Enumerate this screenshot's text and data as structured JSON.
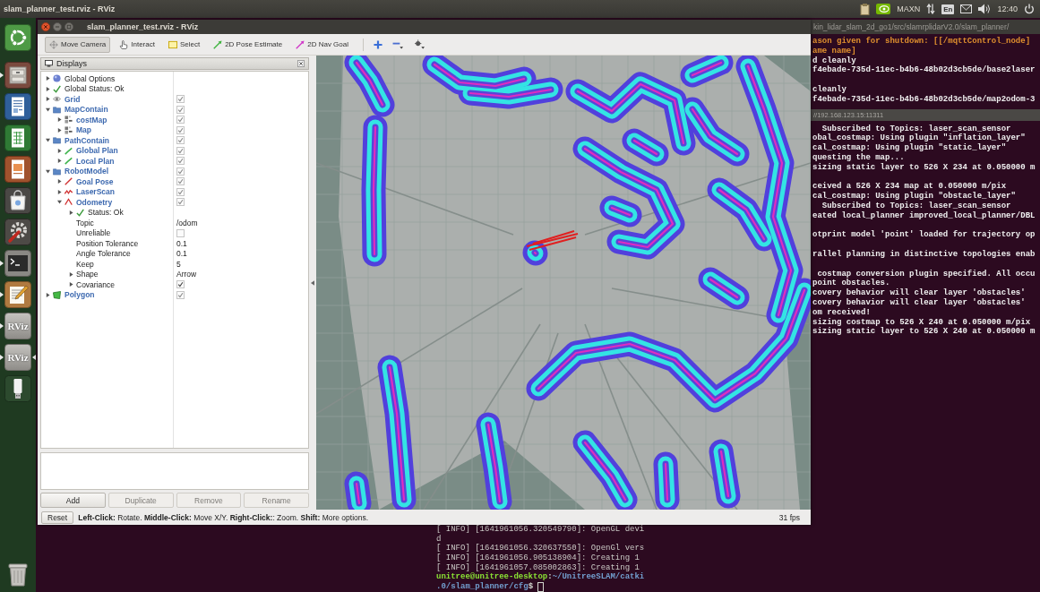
{
  "top_panel": {
    "title": "slam_planner_test.rviz - RViz",
    "power_mode": "MAXN",
    "keyboard_layout": "En",
    "clock": "12:40"
  },
  "launcher": {
    "items": [
      {
        "kind": "dash",
        "running": false,
        "focused": false
      },
      {
        "kind": "files",
        "running": true,
        "focused": false
      },
      {
        "kind": "writer",
        "running": false,
        "focused": false
      },
      {
        "kind": "calc",
        "running": false,
        "focused": false
      },
      {
        "kind": "impress",
        "running": false,
        "focused": false
      },
      {
        "kind": "software",
        "running": false,
        "focused": false
      },
      {
        "kind": "settings",
        "running": false,
        "focused": false
      },
      {
        "kind": "terminal",
        "running": true,
        "focused": false
      },
      {
        "kind": "editor",
        "running": true,
        "focused": false
      },
      {
        "kind": "rviz",
        "label": "RViz",
        "running": true,
        "focused": false
      },
      {
        "kind": "rviz",
        "label": "RViz",
        "running": true,
        "focused": true
      },
      {
        "kind": "usb",
        "running": false,
        "focused": false
      },
      {
        "kind": "trash",
        "running": false,
        "focused": false
      }
    ]
  },
  "rviz_window": {
    "title": "slam_planner_test.rviz - RViz",
    "tools": [
      {
        "kind": "move_camera",
        "label": "Move Camera",
        "selected": true
      },
      {
        "kind": "interact",
        "label": "Interact",
        "selected": false
      },
      {
        "kind": "select",
        "label": "Select",
        "selected": false
      },
      {
        "kind": "pose_estimate",
        "label": "2D Pose Estimate",
        "selected": false
      },
      {
        "kind": "nav_goal",
        "label": "2D Nav Goal",
        "selected": false
      }
    ],
    "displays": {
      "title": "Displays",
      "items": [
        {
          "kind": "options",
          "label": "Global Options",
          "expanded": false
        },
        {
          "kind": "status",
          "label": "Global Status: Ok",
          "expanded": false
        },
        {
          "kind": "grid",
          "label": "Grid",
          "expanded": false,
          "checked": true
        },
        {
          "kind": "group",
          "label": "MapContain",
          "expanded": true,
          "checked": true,
          "children": [
            {
              "kind": "map",
              "label": "costMap",
              "expanded": false,
              "checked": true
            },
            {
              "kind": "map",
              "label": "Map",
              "expanded": false,
              "checked": true
            }
          ]
        },
        {
          "kind": "group",
          "label": "PathContain",
          "expanded": true,
          "checked": true,
          "children": [
            {
              "kind": "path",
              "label": "Global Plan",
              "expanded": false,
              "checked": true
            },
            {
              "kind": "path",
              "label": "Local Plan",
              "expanded": false,
              "checked": true
            }
          ]
        },
        {
          "kind": "group",
          "label": "RobotModel",
          "expanded": true,
          "checked": true,
          "children": [
            {
              "kind": "pose",
              "label": "Goal Pose",
              "expanded": false,
              "checked": true
            },
            {
              "kind": "laser",
              "label": "LaserScan",
              "expanded": false,
              "checked": true
            },
            {
              "kind": "odometry",
              "label": "Odometry",
              "expanded": true,
              "checked": true,
              "children": [
                {
                  "kind": "status",
                  "label": "Status: Ok",
                  "expanded": false
                },
                {
                  "kind": "property",
                  "label": "Topic",
                  "value": "/odom"
                },
                {
                  "kind": "property",
                  "label": "Unreliable",
                  "checked": false
                },
                {
                  "kind": "property",
                  "label": "Position Tolerance",
                  "value": "0.1"
                },
                {
                  "kind": "property",
                  "label": "Angle Tolerance",
                  "value": "0.1"
                },
                {
                  "kind": "property",
                  "label": "Keep",
                  "value": "5"
                },
                {
                  "kind": "property",
                  "label": "Shape",
                  "value": "Arrow",
                  "expanded": false
                },
                {
                  "kind": "property",
                  "label": "Covariance",
                  "expanded": false,
                  "checked": true
                }
              ]
            }
          ]
        },
        {
          "kind": "polygon",
          "label": "Polygon",
          "expanded": false,
          "checked": true
        }
      ]
    },
    "display_buttons": [
      {
        "label": "Add",
        "disabled": false
      },
      {
        "label": "Duplicate",
        "disabled": true
      },
      {
        "label": "Remove",
        "disabled": true
      },
      {
        "label": "Rename",
        "disabled": true
      }
    ],
    "status_bar": {
      "reset": "Reset",
      "hint": "**Left-Click:** Rotate. **Middle-Click:** Move X/Y. **Right-Click:**: Zoom. **Shift:** More options.",
      "fps": "31 fps"
    }
  },
  "right_terminal": {
    "title": "kin_lidar_slam_2d_go1/src/slamrplidarV2.0/slam_planner/",
    "blocks": [
      [
        {
          "text": "ason given for shutdown: [[/mqttControl_node]",
          "kind": "warning"
        },
        {
          "text": "ame name]",
          "kind": "warning"
        },
        {
          "text": "d cleanly",
          "kind": "output"
        },
        {
          "text": "f4ebade-735d-11ec-b4b6-48b02d3cb5de/base2laser",
          "kind": "output"
        }
      ],
      [
        {
          "text": "cleanly",
          "kind": "output"
        },
        {
          "text": "f4ebade-735d-11ec-b4b6-48b02d3cb5de/map2odom-3",
          "kind": "output"
        }
      ]
    ],
    "tab_title": "//192.168.123.15:11311",
    "tab_blocks": [
      [
        {
          "text": "  Subscribed to Topics: laser_scan_sensor",
          "kind": "output"
        },
        {
          "text": "obal_costmap: Using plugin \"inflation_layer\"",
          "kind": "output"
        },
        {
          "text": "cal_costmap: Using plugin \"static_layer\"",
          "kind": "output"
        },
        {
          "text": "questing the map...",
          "kind": "output"
        },
        {
          "text": "sizing static layer to 526 X 234 at 0.050000 m",
          "kind": "output"
        }
      ],
      [
        {
          "text": "ceived a 526 X 234 map at 0.050000 m/pix",
          "kind": "output"
        },
        {
          "text": "cal_costmap: Using plugin \"obstacle_layer\"",
          "kind": "output"
        },
        {
          "text": "  Subscribed to Topics: laser_scan_sensor",
          "kind": "output"
        },
        {
          "text": "eated local_planner improved_local_planner/DBL",
          "kind": "output"
        }
      ],
      [
        {
          "text": "otprint model 'point' loaded for trajectory op",
          "kind": "output"
        }
      ],
      [
        {
          "text": "rallel planning in distinctive topologies enab",
          "kind": "output"
        }
      ],
      [
        {
          "text": " costmap conversion plugin specified. All occu",
          "kind": "output"
        },
        {
          "text": "point obstacles.",
          "kind": "output"
        },
        {
          "text": "covery behavior will clear layer 'obstacles'",
          "kind": "output"
        },
        {
          "text": "covery behavior will clear layer 'obstacles'",
          "kind": "output"
        },
        {
          "text": "om received!",
          "kind": "output"
        },
        {
          "text": "sizing costmap to 526 X 240 at 0.050000 m/pix",
          "kind": "output"
        },
        {
          "text": "sizing static layer to 526 X 240 at 0.050000 m",
          "kind": "output"
        }
      ]
    ]
  },
  "bottom_terminal": {
    "lines": [
      "[ INFO] [1641961056.320549790]: OpenGL devi",
      "d",
      "[ INFO] [1641961056.320637550]: OpenGl vers",
      "[ INFO] [1641961056.905138904]: Creating 1",
      "[ INFO] [1641961057.085002863]: Creating 1"
    ],
    "prompt": [
      [
        {
          "text": "unitree@unitree-desktop",
          "kind": "user"
        },
        {
          "text": ":",
          "kind": "plain"
        },
        {
          "text": "~/UnitreeSLAM/catki",
          "kind": "path"
        }
      ],
      [
        {
          "text": ".0/slam_planner/cfg",
          "kind": "path"
        },
        {
          "text": "$",
          "kind": "plain"
        }
      ]
    ]
  }
}
